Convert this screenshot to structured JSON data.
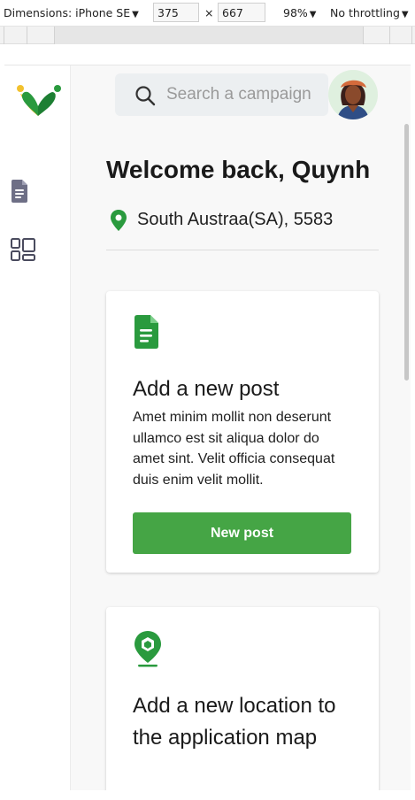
{
  "devtools": {
    "device_label": "Dimensions: iPhone SE",
    "width_value": "375",
    "times": "×",
    "height_value": "667",
    "zoom_label": "98%",
    "throttle_label": "No throttling"
  },
  "search": {
    "placeholder": "Search a campaign"
  },
  "welcome": {
    "title": "Welcome back, Quynh"
  },
  "location": {
    "text": "South Austraa(SA), 5583"
  },
  "cards": [
    {
      "title": "Add a new post",
      "body": "Amet minim mollit non deserunt ullamco est sit aliqua dolor do amet sint. Velit officia consequat duis enim velit mollit.",
      "button_label": "New post"
    },
    {
      "title": "Add a new location to the application map"
    }
  ],
  "colors": {
    "brand_green": "#45a545",
    "icon_green": "#2a9a3e",
    "logo_yellow": "#f2c12e"
  },
  "icons": [
    "logo",
    "document-icon",
    "dashboard-icon",
    "search-icon",
    "location-pin-icon",
    "post-document-icon",
    "map-location-icon"
  ]
}
